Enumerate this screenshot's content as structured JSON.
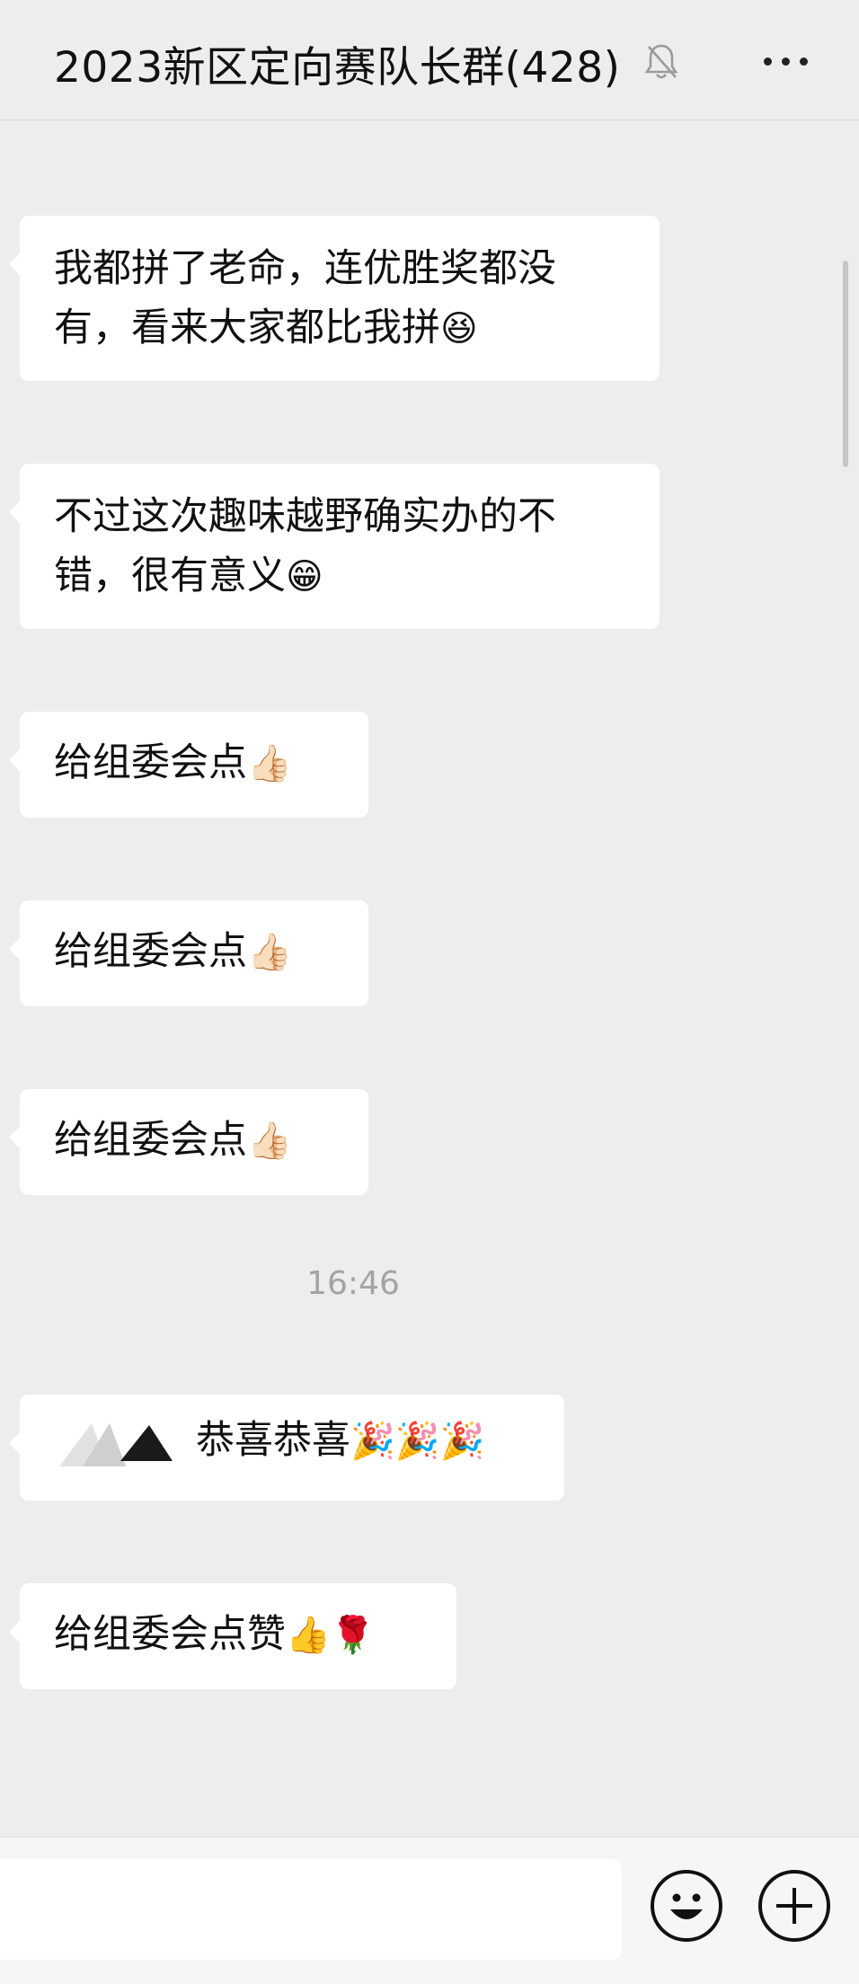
{
  "header": {
    "title": "2023新区定向赛队长群(428)",
    "mute_icon": "bell-muted-icon",
    "more_icon": "more-dots-icon"
  },
  "messages": [
    {
      "line1": "我都拼了老命，连优胜奖都没",
      "line2": "有，看来大家都比我拼",
      "emoji": "😆"
    },
    {
      "line1": "不过这次趣味越野确实办的不",
      "line2": "错，很有意义",
      "emoji": "😁"
    },
    {
      "text": "给组委会点",
      "emoji": "👍🏻"
    },
    {
      "text": "给组委会点",
      "emoji": "👍🏻"
    },
    {
      "text": "给组委会点",
      "emoji": "👍🏻"
    },
    {
      "text": "恭喜恭喜",
      "emoji": "🎉🎉🎉",
      "sticker_icon": "black-triangle-sticker-icon"
    },
    {
      "text": "给组委会点赞",
      "emoji": "👍🌹"
    }
  ],
  "timestamp": "16:46",
  "input_bar": {
    "emoji_button": "emoji-face-icon",
    "plus_button": "plus-icon"
  },
  "colors": {
    "background": "#ededed",
    "bubble": "#ffffff",
    "timestamp": "#a3a3a3"
  }
}
